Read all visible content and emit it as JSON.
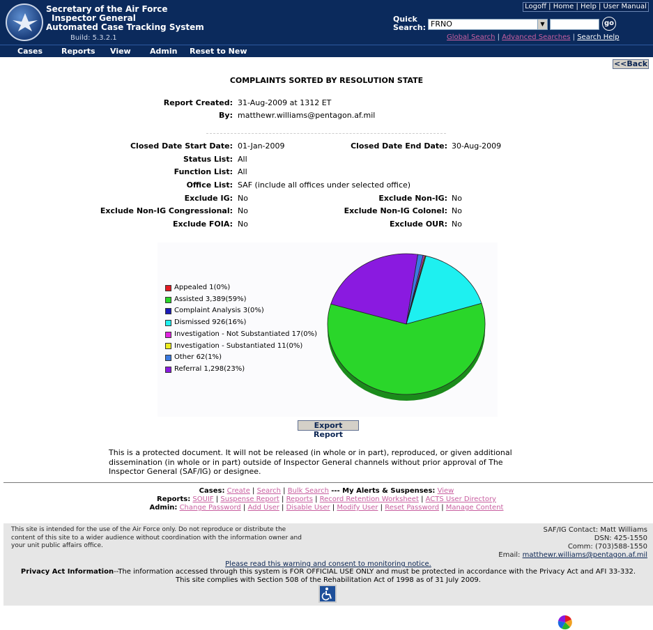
{
  "header": {
    "title_line1": "Secretary of the Air Force",
    "title_line2": "Inspector General",
    "title_line3": "Automated Case Tracking System",
    "build": "Build: 5.3.2.1",
    "top_links": [
      "Logoff",
      "Home",
      "Help",
      "User Manual"
    ],
    "quick_search_label_1": "Quick",
    "quick_search_label_2": "Search:",
    "quick_search_select": "FRNO",
    "quick_search_value": "",
    "go_label": "go",
    "global_search": "Global Search",
    "advanced_searches": "Advanced Searches",
    "search_help": "Search Help"
  },
  "menu": [
    "Cases",
    "Reports",
    "View",
    "Admin",
    "Reset to New"
  ],
  "back_label": "<<Back",
  "report": {
    "title": "COMPLAINTS SORTED BY RESOLUTION STATE",
    "created_label": "Report Created:",
    "created_value": "31-Aug-2009 at 1312 ET",
    "by_label": "By:",
    "by_value": "matthewr.williams@pentagon.af.mil",
    "closed_start_label": "Closed Date Start Date:",
    "closed_start_value": "01-Jan-2009",
    "closed_end_label": "Closed Date End Date:",
    "closed_end_value": "30-Aug-2009",
    "status_label": "Status List:",
    "status_value": "All",
    "function_label": "Function List:",
    "function_value": "All",
    "office_label": "Office List:",
    "office_value": "SAF (include all offices under selected office)",
    "exclude_ig_label": "Exclude IG:",
    "exclude_ig_value": "No",
    "exclude_nonig_label": "Exclude Non-IG:",
    "exclude_nonig_value": "No",
    "exclude_nonig_cong_label": "Exclude Non-IG Congressional:",
    "exclude_nonig_cong_value": "No",
    "exclude_nonig_col_label": "Exclude Non-IG Colonel:",
    "exclude_nonig_col_value": "No",
    "exclude_foia_label": "Exclude FOIA:",
    "exclude_foia_value": "No",
    "exclude_our_label": "Exclude OUR:",
    "exclude_our_value": "No"
  },
  "chart_data": {
    "type": "pie",
    "slices": [
      {
        "name": "Appealed",
        "label": "Appealed 1(0%)",
        "value": 1,
        "color": "#e31b23"
      },
      {
        "name": "Assisted",
        "label": "Assisted 3,389(59%)",
        "value": 3389,
        "color": "#2ad62a"
      },
      {
        "name": "Complaint Analysis",
        "label": "Complaint Analysis 3(0%)",
        "value": 3,
        "color": "#1a1ab8"
      },
      {
        "name": "Dismissed",
        "label": "Dismissed 926(16%)",
        "value": 926,
        "color": "#1ef0f0"
      },
      {
        "name": "Investigation - Not Substantiated",
        "label": "Investigation - Not Substantiated 17(0%)",
        "value": 17,
        "color": "#e024e0"
      },
      {
        "name": "Investigation - Substantiated",
        "label": "Investigation - Substantiated 11(0%)",
        "value": 11,
        "color": "#eded20"
      },
      {
        "name": "Other",
        "label": "Other 62(1%)",
        "value": 62,
        "color": "#3a7ae0"
      },
      {
        "name": "Referral",
        "label": "Referral 1,298(23%)",
        "value": 1298,
        "color": "#8a1ae0"
      }
    ]
  },
  "export_label": "Export Report",
  "notice": "This is a protected document. It will not be released (in whole or in part), reproduced, or given additional dissemination (in whole or in part) outside of Inspector General channels without prior approval of The Inspector General (SAF/IG) or designee.",
  "footer_links": {
    "cases_label": "Cases:",
    "cases": [
      "Create",
      "Search",
      "Bulk Search"
    ],
    "alerts_label": "--- My Alerts & Suspenses:",
    "alerts_view": "View",
    "reports_label": "Reports:",
    "reports": [
      "SOUIF",
      "Suspense Report",
      "Reports",
      "Record Retention Worksheet",
      "ACTS User Directory"
    ],
    "admin_label": "Admin:",
    "admin": [
      "Change Password",
      "Add User",
      "Disable User",
      "Modify User",
      "Reset Password",
      "Manage Content"
    ]
  },
  "bottom": {
    "disclaimer": "This site is intended for the use of the Air Force only. Do not reproduce or distribute the content of this site to a wider audience without coordination with the information owner and your unit public affairs office.",
    "contact_line": "SAF/IG Contact: Matt Williams",
    "dsn": "DSN: 425-1550",
    "comm": "Comm: (703)588-1550",
    "email_label": "Email:",
    "email": "matthewr.williams@pentagon.af.mil",
    "warning_link": "Please read this warning and consent to monitoring notice.",
    "privacy_label": "Privacy Act Information",
    "privacy_text": "--The information accessed through this system is FOR OFFICIAL USE ONLY and must be protected in accordance with the Privacy Act and AFI 33-332.",
    "section508": "This site complies with Section 508 of the Rehabilitation Act of 1998 as of 31 July 2009."
  }
}
